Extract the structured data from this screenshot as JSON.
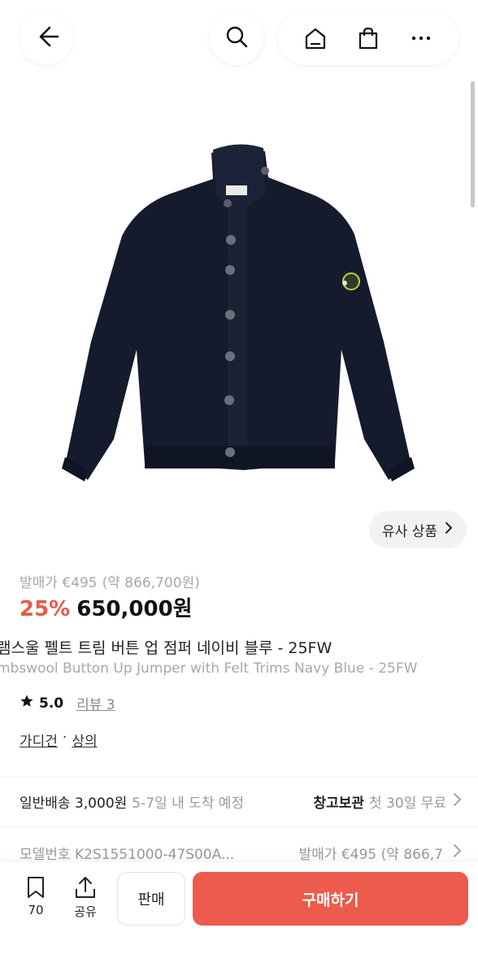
{
  "header": {
    "icons": [
      "back-arrow-icon",
      "search-icon",
      "home-icon",
      "shopping-bag-icon",
      "more-icon"
    ]
  },
  "similar_button": {
    "label": "유사 상품",
    "icon": "chevron-right-icon"
  },
  "pricing": {
    "original_label": "발매가 €495",
    "original_converted": "(약 866,700원)",
    "discount": "25%",
    "price": "650,000원",
    "discount_color": "#ea5a47"
  },
  "title": {
    "korean": "램스울 펠트 트림 버튼 업 점퍼 네이비 블루 - 25FW",
    "english": "mbswool Button Up Jumper with Felt Trims Navy Blue - 25FW"
  },
  "rating": {
    "score": "5.0",
    "review_label": "리뷰 3"
  },
  "category": {
    "primary": "가디건",
    "separator": "·",
    "secondary": "상의"
  },
  "shipping": {
    "main": "일반배송 3,000원",
    "sub": "5-7일 내 도착 예정",
    "storage_label": "창고보관",
    "storage_sub": "첫 30일 무료"
  },
  "model": {
    "left": "모델번호 K2S1551000-47S00A...",
    "right": "발매가 €495 (약 866,7"
  },
  "bottom_bar": {
    "like_count": "70",
    "share_label": "공유",
    "sell_label": "판매",
    "buy_label": "구매하기",
    "buy_color": "#ec5b4b"
  }
}
